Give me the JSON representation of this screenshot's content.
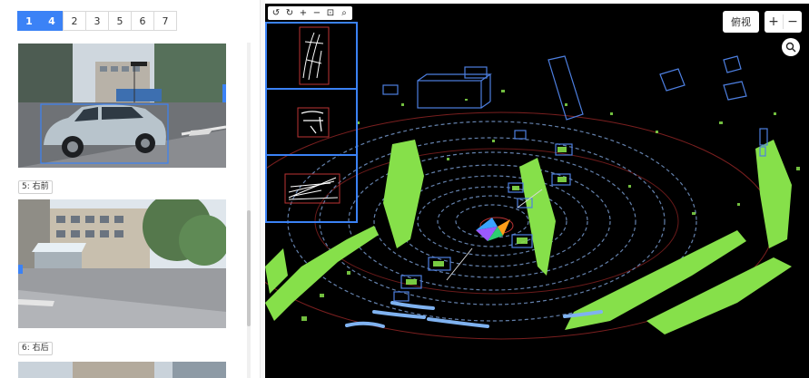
{
  "pager": {
    "items": [
      "1",
      "4",
      "2",
      "3",
      "5",
      "6",
      "7"
    ],
    "active": [
      0,
      1
    ]
  },
  "cameras": [
    {
      "label": ""
    },
    {
      "label": "5: 右前"
    },
    {
      "label": ""
    },
    {
      "label": "6: 右后"
    }
  ],
  "viewer": {
    "toolbar": {
      "rotate_left_icon": "↺",
      "rotate_right_icon": "↻",
      "zoom_in_icon": "+",
      "zoom_out_icon": "−",
      "fit_icon": "⊡",
      "search_icon": "⌕"
    },
    "view_button": "俯视",
    "zoom_in": "+",
    "zoom_out": "−"
  },
  "colors": {
    "accent": "#3b82f6",
    "points": "#86e04a",
    "boxes": "#4d7fe0",
    "ring": "#c0392b"
  }
}
